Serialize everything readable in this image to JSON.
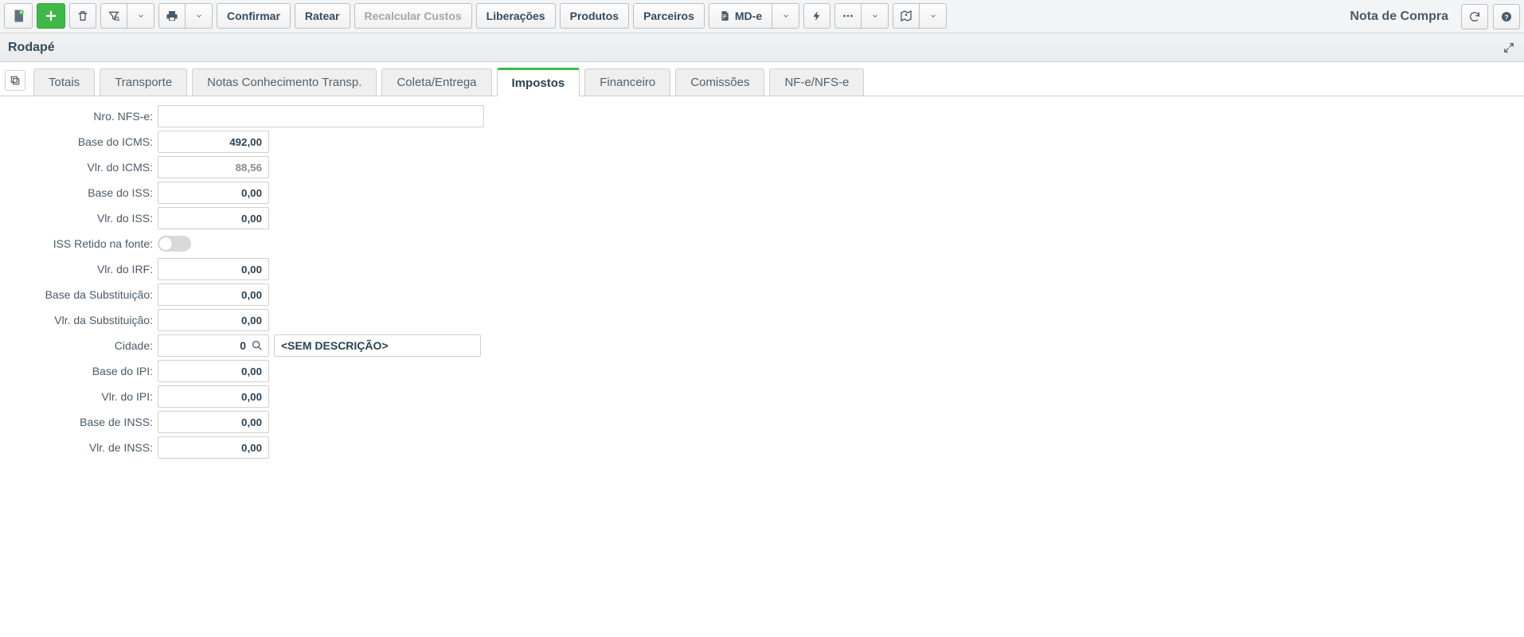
{
  "toolbar": {
    "confirmar": "Confirmar",
    "ratear": "Ratear",
    "recalcular": "Recalcular Custos",
    "liberacoes": "Liberações",
    "produtos": "Produtos",
    "parceiros": "Parceiros",
    "mde": "MD-e"
  },
  "title": "Nota de Compra",
  "section_title": "Rodapé",
  "tabs": {
    "totais": "Totais",
    "transporte": "Transporte",
    "notas_conhecimento": "Notas Conhecimento Transp.",
    "coleta_entrega": "Coleta/Entrega",
    "impostos": "Impostos",
    "financeiro": "Financeiro",
    "comissoes": "Comissões",
    "nfe_nfse": "NF-e/NFS-e"
  },
  "form": {
    "labels": {
      "nro_nfse": "Nro. NFS-e:",
      "base_icms": "Base do ICMS:",
      "vlr_icms": "Vlr. do ICMS:",
      "base_iss": "Base do ISS:",
      "vlr_iss": "Vlr. do ISS:",
      "iss_retido": "ISS Retido na fonte:",
      "vlr_irf": "Vlr. do IRF:",
      "base_subst": "Base da Substituição:",
      "vlr_subst": "Vlr. da Substituição:",
      "cidade": "Cidade:",
      "base_ipi": "Base do IPI:",
      "vlr_ipi": "Vlr. do IPI:",
      "base_inss": "Base de INSS:",
      "vlr_inss": "Vlr. de INSS:"
    },
    "values": {
      "nro_nfse": "",
      "base_icms": "492,00",
      "vlr_icms": "88,56",
      "base_iss": "0,00",
      "vlr_iss": "0,00",
      "iss_retido": false,
      "vlr_irf": "0,00",
      "base_subst": "0,00",
      "vlr_subst": "0,00",
      "cidade_code": "0",
      "cidade_desc": "<SEM DESCRIÇÃO>",
      "base_ipi": "0,00",
      "vlr_ipi": "0,00",
      "base_inss": "0,00",
      "vlr_inss": "0,00"
    }
  }
}
